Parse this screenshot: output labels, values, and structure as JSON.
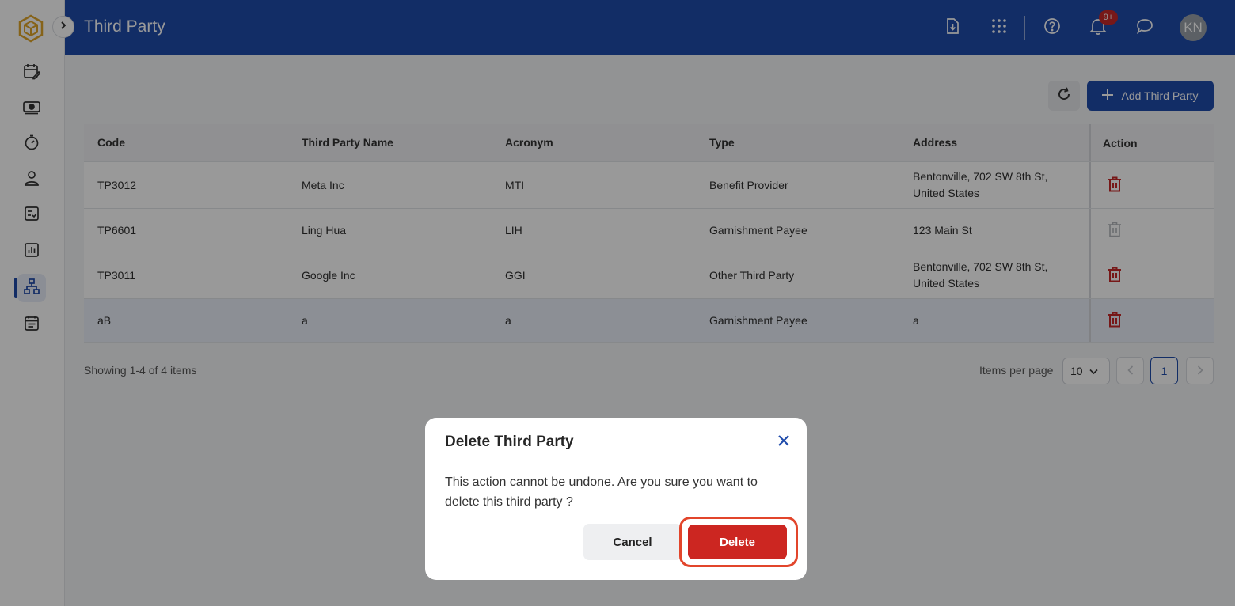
{
  "header": {
    "title": "Third Party",
    "notification_badge": "9+",
    "avatar_initials": "KN"
  },
  "rail": {
    "items": [
      "calendar-edit-icon",
      "money-icon",
      "timer-icon",
      "user-icon",
      "checklist-icon",
      "chart-icon",
      "org-chart-icon",
      "calendar-list-icon"
    ],
    "active": "org-chart-icon"
  },
  "toolbar": {
    "add_label": "Add Third Party"
  },
  "table": {
    "columns": [
      "Code",
      "Third Party Name",
      "Acronym",
      "Type",
      "Address",
      "Action"
    ],
    "rows": [
      {
        "code": "TP3012",
        "name": "Meta Inc",
        "acronym": "MTI",
        "type": "Benefit Provider",
        "address": "Bentonville, 702 SW 8th St, United States",
        "delete_enabled": true
      },
      {
        "code": "TP6601",
        "name": "Ling Hua",
        "acronym": "LIH",
        "type": "Garnishment Payee",
        "address": "123 Main St",
        "delete_enabled": false
      },
      {
        "code": "TP3011",
        "name": "Google Inc",
        "acronym": "GGI",
        "type": "Other Third Party",
        "address": "Bentonville, 702 SW 8th St, United States",
        "delete_enabled": true
      },
      {
        "code": "aB",
        "name": "a",
        "acronym": "a",
        "type": "Garnishment Payee",
        "address": "a",
        "delete_enabled": true
      }
    ]
  },
  "pagination": {
    "showing": "Showing 1-4 of 4 items",
    "items_per_page_label": "Items per page",
    "items_per_page_value": "10",
    "current_page": "1"
  },
  "modal": {
    "title": "Delete Third Party",
    "message": "This action cannot be undone. Are you sure you want to delete this third party ?",
    "cancel_label": "Cancel",
    "delete_label": "Delete"
  },
  "colors": {
    "brand_blue": "#1f4bab",
    "danger_red": "#cc2621",
    "highlight_ring": "#e2452b"
  }
}
